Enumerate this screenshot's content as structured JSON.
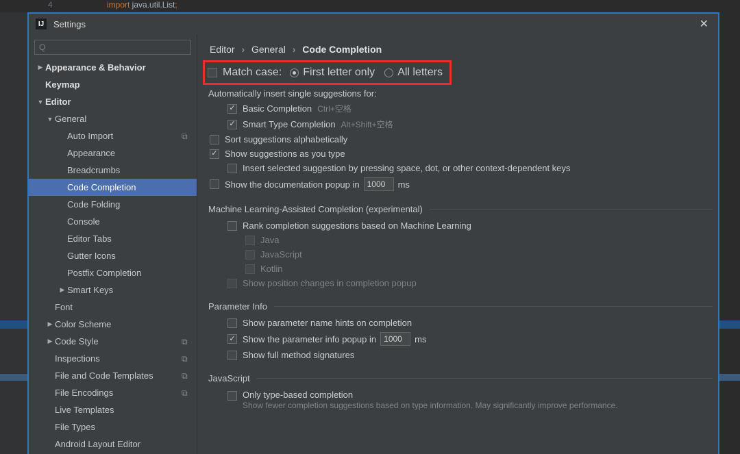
{
  "bg_code": {
    "line_number": "4",
    "keyword": "import",
    "rest": " java.util.List",
    "semi": ";"
  },
  "title": "Settings",
  "search_placeholder": "",
  "tree": [
    {
      "label": "Appearance & Behavior",
      "indent": 0,
      "arrow": "right",
      "bold": true
    },
    {
      "label": "Keymap",
      "indent": 0,
      "arrow": "",
      "bold": true
    },
    {
      "label": "Editor",
      "indent": 0,
      "arrow": "down",
      "bold": true
    },
    {
      "label": "General",
      "indent": 1,
      "arrow": "down"
    },
    {
      "label": "Auto Import",
      "indent": 2,
      "arrow": "",
      "badge": true
    },
    {
      "label": "Appearance",
      "indent": 2,
      "arrow": ""
    },
    {
      "label": "Breadcrumbs",
      "indent": 2,
      "arrow": ""
    },
    {
      "label": "Code Completion",
      "indent": 2,
      "arrow": "",
      "selected": true
    },
    {
      "label": "Code Folding",
      "indent": 2,
      "arrow": ""
    },
    {
      "label": "Console",
      "indent": 2,
      "arrow": ""
    },
    {
      "label": "Editor Tabs",
      "indent": 2,
      "arrow": ""
    },
    {
      "label": "Gutter Icons",
      "indent": 2,
      "arrow": ""
    },
    {
      "label": "Postfix Completion",
      "indent": 2,
      "arrow": ""
    },
    {
      "label": "Smart Keys",
      "indent": 2,
      "arrow": "right"
    },
    {
      "label": "Font",
      "indent": 1,
      "arrow": ""
    },
    {
      "label": "Color Scheme",
      "indent": 1,
      "arrow": "right"
    },
    {
      "label": "Code Style",
      "indent": 1,
      "arrow": "right",
      "badge": true
    },
    {
      "label": "Inspections",
      "indent": 1,
      "arrow": "",
      "badge": true
    },
    {
      "label": "File and Code Templates",
      "indent": 1,
      "arrow": "",
      "badge": true
    },
    {
      "label": "File Encodings",
      "indent": 1,
      "arrow": "",
      "badge": true
    },
    {
      "label": "Live Templates",
      "indent": 1,
      "arrow": ""
    },
    {
      "label": "File Types",
      "indent": 1,
      "arrow": ""
    },
    {
      "label": "Android Layout Editor",
      "indent": 1,
      "arrow": ""
    }
  ],
  "breadcrumb": {
    "a": "Editor",
    "b": "General",
    "c": "Code Completion"
  },
  "match_case": {
    "label": "Match case:",
    "opt1": "First letter only",
    "opt2": "All letters"
  },
  "auto_insert_header": "Automatically insert single suggestions for:",
  "basic_label": "Basic Completion",
  "basic_shortcut": "Ctrl+空格",
  "smart_label": "Smart Type Completion",
  "smart_shortcut": "Alt+Shift+空格",
  "sort_label": "Sort suggestions alphabetically",
  "show_as_type_label": "Show suggestions as you type",
  "insert_sel_label": "Insert selected suggestion by pressing space, dot, or other context-dependent keys",
  "doc_popup_pre": "Show the documentation popup in",
  "doc_popup_val": "1000",
  "doc_popup_post": "ms",
  "ml_section": "Machine Learning-Assisted Completion (experimental)",
  "ml_rank_label": "Rank completion suggestions based on Machine Learning",
  "ml_langs": [
    "Java",
    "JavaScript",
    "Kotlin"
  ],
  "ml_pos_label": "Show position changes in completion popup",
  "param_section": "Parameter Info",
  "param_hints_label": "Show parameter name hints on completion",
  "param_popup_pre": "Show the parameter info popup in",
  "param_popup_val": "1000",
  "param_popup_post": "ms",
  "full_sig_label": "Show full method signatures",
  "js_section": "JavaScript",
  "js_only_type_label": "Only type-based completion",
  "js_only_type_desc": "Show fewer completion suggestions based on type information. May significantly improve performance."
}
